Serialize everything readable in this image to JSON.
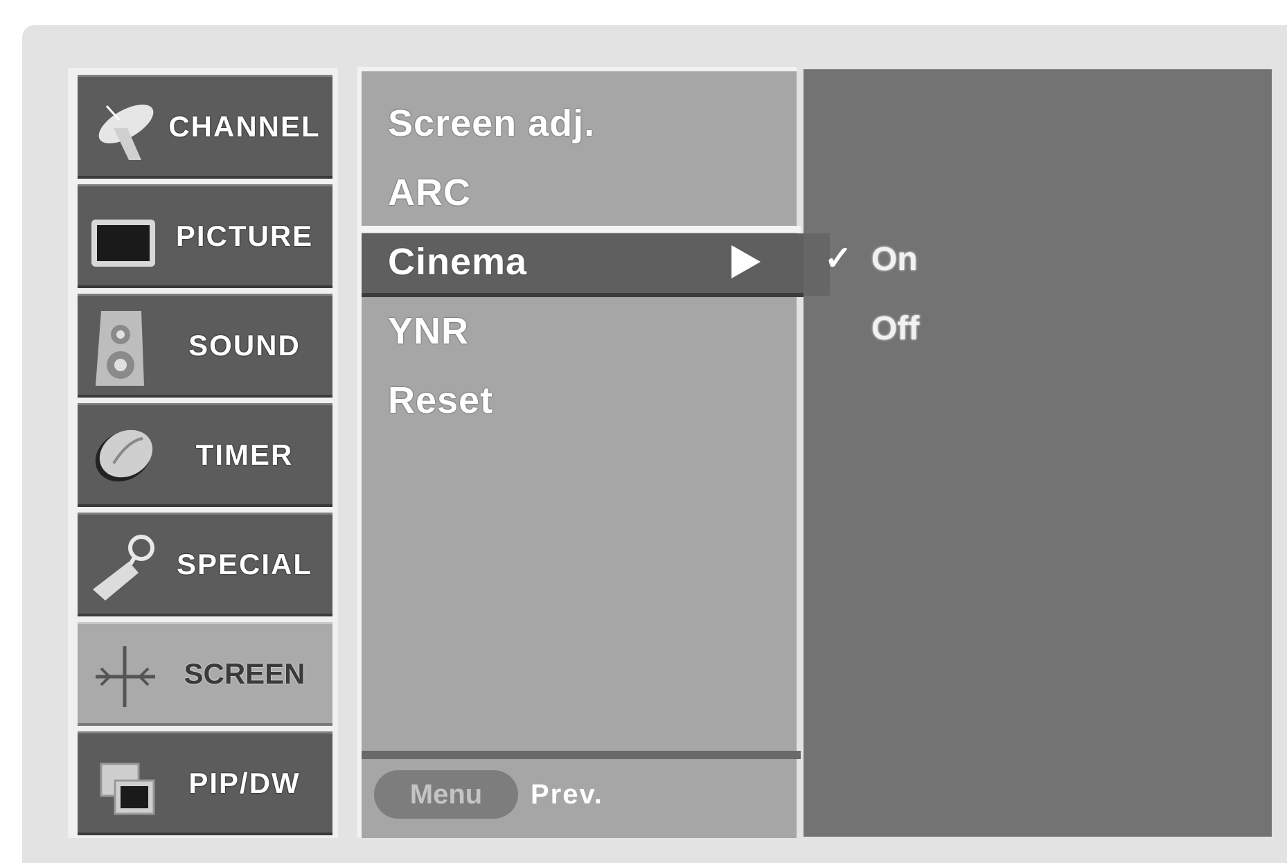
{
  "sidebar": {
    "items": [
      {
        "label": "CHANNEL",
        "icon": "satellite-dish-icon"
      },
      {
        "label": "PICTURE",
        "icon": "tv-screen-icon"
      },
      {
        "label": "SOUND",
        "icon": "speaker-icon"
      },
      {
        "label": "TIMER",
        "icon": "clock-icon"
      },
      {
        "label": "SPECIAL",
        "icon": "key-tag-icon"
      },
      {
        "label": "SCREEN",
        "icon": "screen-adjust-icon",
        "selected": true
      },
      {
        "label": "PIP/DW",
        "icon": "pip-windows-icon"
      }
    ]
  },
  "submenu": {
    "items": [
      "Screen adj.",
      "ARC",
      "Cinema",
      "YNR",
      "Reset"
    ],
    "selected": "Cinema"
  },
  "options": {
    "items": [
      "On",
      "Off"
    ],
    "checked": "On"
  },
  "footer": {
    "menu_button": "Menu",
    "prev_label": "Prev."
  },
  "colors": {
    "frame_bg": "#e3e3e3",
    "tab_bg": "#5c5c5c",
    "tab_selected_bg": "#aaaaaa",
    "submenu_bg": "#a6a6a6",
    "highlight_bg": "#5f5f5f",
    "option_panel_bg": "#737373"
  }
}
